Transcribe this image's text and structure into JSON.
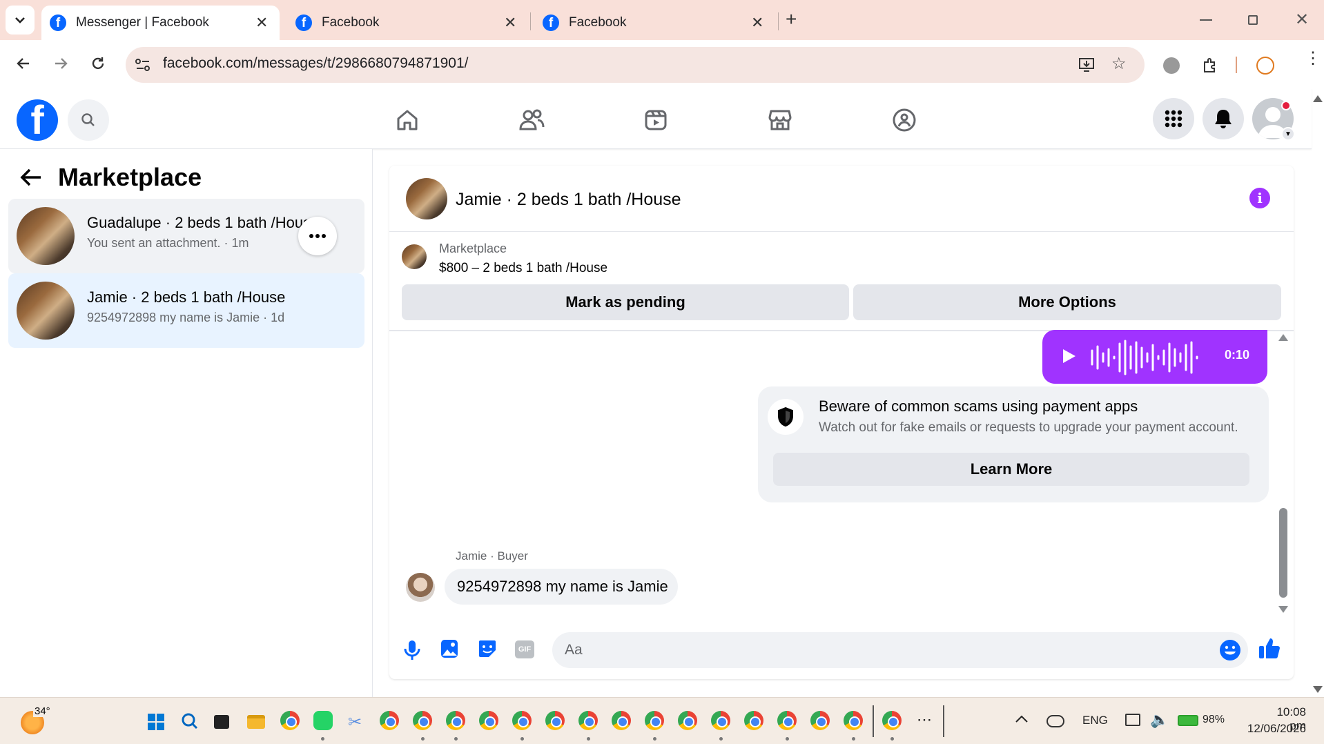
{
  "browser": {
    "tabs": [
      {
        "label": "Messenger | Facebook",
        "active": true
      },
      {
        "label": "Facebook",
        "active": false
      },
      {
        "label": "Facebook",
        "active": false
      }
    ],
    "url": "facebook.com/messages/t/2986680794871901/"
  },
  "facebook": {
    "brand_color": "#0866ff",
    "logo_letter": "f"
  },
  "sidebar": {
    "title": "Marketplace",
    "conversations": [
      {
        "name": "Guadalupe · 2 beds 1 bath /House",
        "preview": "You sent an attachment. · 1m",
        "selected": false,
        "hovered": true
      },
      {
        "name": "Jamie · 2 beds 1 bath /House",
        "preview": "9254972898 my name is Jamie · 1d",
        "selected": true
      }
    ]
  },
  "chat": {
    "header_title": "Jamie · 2 beds 1 bath /House",
    "listing": {
      "label": "Marketplace",
      "detail": "$800 – 2 beds 1 bath /House"
    },
    "buttons": {
      "pending": "Mark as pending",
      "more": "More Options"
    },
    "voice_message": {
      "duration": "0:10",
      "color": "#a033ff"
    },
    "scam_notice": {
      "title": "Beware of common scams using payment apps",
      "body": "Watch out for fake emails or requests to upgrade your payment account.",
      "button": "Learn More"
    },
    "incoming": {
      "sender_label": "Jamie · Buyer",
      "text": "9254972898 my name is Jamie"
    },
    "composer": {
      "placeholder": "Aa"
    }
  },
  "taskbar": {
    "weather": "34°",
    "language": "ENG",
    "battery": "98%",
    "time": "10:08 pm",
    "date": "12/06/2026"
  }
}
